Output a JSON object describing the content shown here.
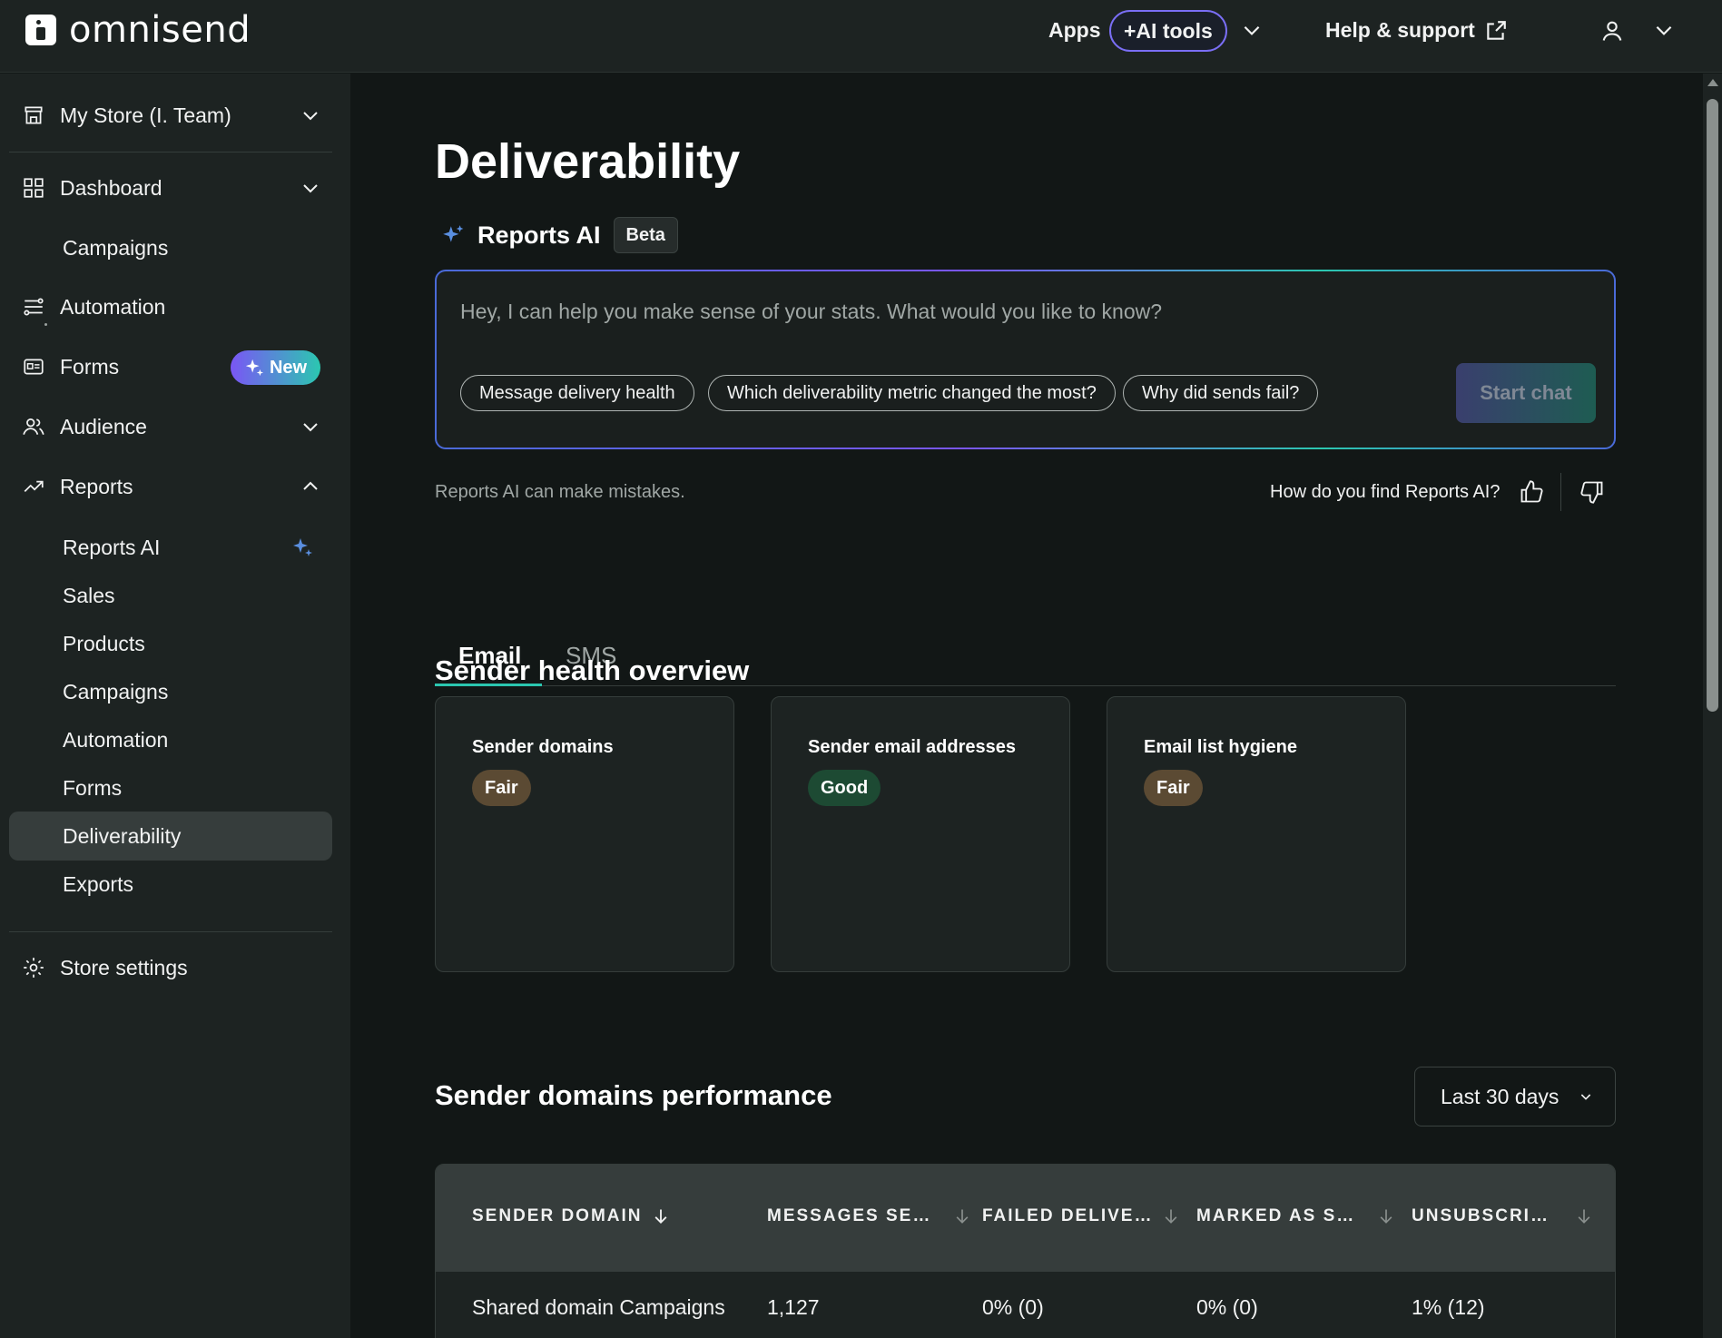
{
  "topbar": {
    "logo_text": "omnisend",
    "apps_label": "Apps",
    "ai_tools_label": "+AI tools",
    "help_label": "Help & support"
  },
  "sidebar": {
    "store_name": "My Store (I. Team)",
    "dashboard": "Dashboard",
    "campaigns": "Campaigns",
    "automation": "Automation",
    "forms": "Forms",
    "new_badge": "New",
    "audience": "Audience",
    "reports": "Reports",
    "reports_sub": [
      {
        "label": "Reports AI"
      },
      {
        "label": "Sales"
      },
      {
        "label": "Products"
      },
      {
        "label": "Campaigns"
      },
      {
        "label": "Automation"
      },
      {
        "label": "Forms"
      },
      {
        "label": "Deliverability"
      },
      {
        "label": "Exports"
      }
    ],
    "store_settings": "Store settings"
  },
  "main": {
    "title": "Deliverability",
    "reports_ai_title": "Reports AI",
    "beta_badge": "Beta",
    "chat_placeholder": "Hey, I can help you make sense of your stats. What would you like to know?",
    "chips": [
      "Message delivery health",
      "Which deliverability metric changed the most?",
      "Why did sends fail?"
    ],
    "start_chat": "Start chat",
    "disclaimer": "Reports AI can make mistakes.",
    "feedback_question": "How do you find Reports AI?",
    "tabs": [
      {
        "label": "Email",
        "active": true
      },
      {
        "label": "SMS",
        "active": false
      }
    ],
    "health_title": "Sender health overview",
    "cards": [
      {
        "title": "Sender domains",
        "status": "Fair",
        "kind": "fair"
      },
      {
        "title": "Sender email addresses",
        "status": "Good",
        "kind": "good"
      },
      {
        "title": "Email list hygiene",
        "status": "Fair",
        "kind": "fair"
      }
    ],
    "performance_title": "Sender domains performance",
    "range": "Last 30 days",
    "table": {
      "headers": [
        "SENDER DOMAIN",
        "MESSAGES SE…",
        "FAILED DELIVE…",
        "MARKED AS S…",
        "UNSUBSCRI…"
      ],
      "rows": [
        [
          "Shared domain Campaigns",
          "1,127",
          "0% (0)",
          "0% (0)",
          "1% (12)"
        ]
      ]
    }
  },
  "colors": {
    "accent_teal": "#2bc7b0",
    "accent_purple": "#7a56f5",
    "fair_badge": "#5b4a33",
    "good_badge": "#1d4a33"
  }
}
